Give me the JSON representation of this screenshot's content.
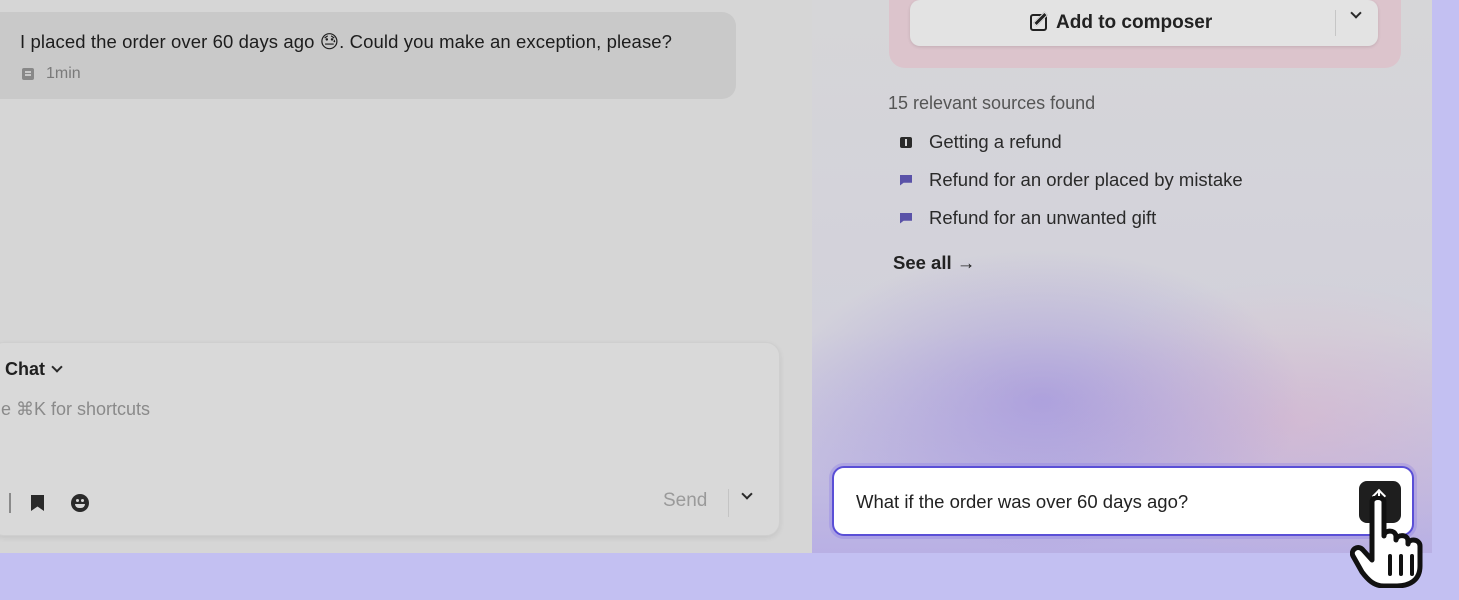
{
  "conversation": {
    "message": "I placed the order over 60 days ago 😓. Could you make an exception, please?",
    "message_time": "1min"
  },
  "composer": {
    "mode_label": "Chat",
    "placeholder": "e ⌘K for shortcuts",
    "send_label": "Send"
  },
  "copilot": {
    "add_to_composer_label": "Add to composer",
    "sources_title": "15 relevant sources found",
    "sources": [
      {
        "icon": "book-icon",
        "label": "Getting a refund"
      },
      {
        "icon": "flag-icon",
        "label": "Refund for an order placed by mistake"
      },
      {
        "icon": "flag-icon",
        "label": "Refund for an unwanted gift"
      }
    ],
    "see_all_label": "See all →",
    "question_value": "What if the order was over 60 days ago?"
  },
  "colors": {
    "accent": "#5a4fd6",
    "page_background": "#c3c0f2",
    "submit_button": "#1e1e1e"
  }
}
